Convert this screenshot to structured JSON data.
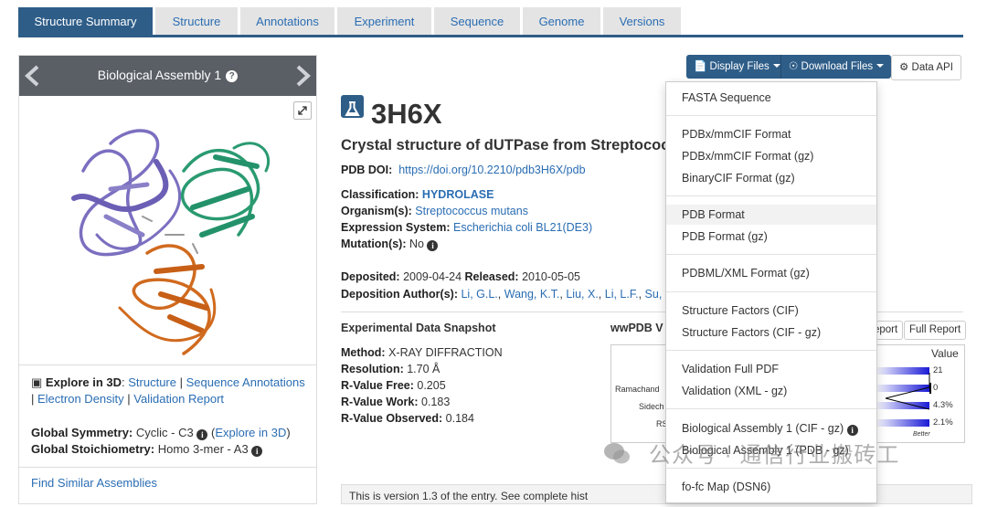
{
  "tabs": [
    "Structure Summary",
    "Structure",
    "Annotations",
    "Experiment",
    "Sequence",
    "Genome",
    "Versions"
  ],
  "left": {
    "carousel_title": "Biological Assembly 1",
    "explore_label": "Explore in 3D",
    "explore_links": [
      "Structure",
      "Sequence Annotations",
      "Electron Density",
      "Validation Report"
    ],
    "global_symmetry_label": "Global Symmetry:",
    "global_symmetry_value": "Cyclic - C3",
    "explore_in_3d": "Explore in 3D",
    "global_stoichiometry_label": "Global Stoichiometry:",
    "global_stoichiometry_value": "Homo 3-mer - A3",
    "find_similar": "Find Similar Assemblies"
  },
  "buttons": {
    "display_files": "Display Files",
    "download_files": "Download Files",
    "data_api": "Data API"
  },
  "entry": {
    "id": "3H6X",
    "title": "Crystal structure of dUTPase from Streptococc",
    "doi_label": "PDB DOI:",
    "doi": "https://doi.org/10.2210/pdb3H6X/pdb",
    "classification_label": "Classification:",
    "classification": "HYDROLASE",
    "organism_label": "Organism(s):",
    "organism": "Streptococcus mutans",
    "expression_label": "Expression System:",
    "expression": "Escherichia coli BL21(DE3)",
    "mutation_label": "Mutation(s):",
    "mutation": "No",
    "deposited_label": "Deposited:",
    "deposited": "2009-04-24",
    "released_label": "Released:",
    "released": "2010-05-05",
    "authors_label": "Deposition Author(s):",
    "authors": [
      "Li, G.L.",
      "Wang, K.T.",
      "Liu, X.",
      "Li, L.F.",
      "Su,"
    ]
  },
  "snapshot": {
    "title": "Experimental Data Snapshot",
    "rows": [
      {
        "label": "Method:",
        "value": "X-RAY DIFFRACTION"
      },
      {
        "label": "Resolution:",
        "value": "1.70 Å"
      },
      {
        "label": "R-Value Free:",
        "value": "0.205"
      },
      {
        "label": "R-Value Work:",
        "value": "0.183"
      },
      {
        "label": "R-Value Observed:",
        "value": "0.184"
      }
    ]
  },
  "validation": {
    "title": "wwPDB V",
    "report_btn": "eport",
    "full_report_btn": "Full Report",
    "value_header": "Value",
    "rows": [
      {
        "label": "",
        "value": "21"
      },
      {
        "label": "Ramachand",
        "value": "0"
      },
      {
        "label": "Sidech",
        "value": "4.3%"
      },
      {
        "label": "RS",
        "value": "2.1%"
      }
    ],
    "better": "Better"
  },
  "dropdown": {
    "groups": [
      [
        "FASTA Sequence"
      ],
      [
        "PDBx/mmCIF Format",
        "PDBx/mmCIF Format (gz)",
        "BinaryCIF Format (gz)"
      ],
      [
        "PDB Format",
        "PDB Format (gz)"
      ],
      [
        "PDBML/XML Format (gz)"
      ],
      [
        "Structure Factors (CIF)",
        "Structure Factors (CIF - gz)"
      ],
      [
        "Validation Full PDF",
        "Validation (XML - gz)"
      ],
      [
        "Biological Assembly 1 (CIF - gz)",
        "Biological Assembly 1 (PDB - gz)"
      ],
      [
        "fo-fc Map (DSN6)"
      ]
    ]
  },
  "bottom_notice": "This is version 1.3 of the entry. See complete hist",
  "watermark": "公众号 · 通信行业搬砖工",
  "colors": {
    "primary": "#2e5d88",
    "link": "#2a6db3",
    "chain_a": "#7b6fc0",
    "chain_b": "#2a9a70",
    "chain_c": "#d06a1e"
  }
}
